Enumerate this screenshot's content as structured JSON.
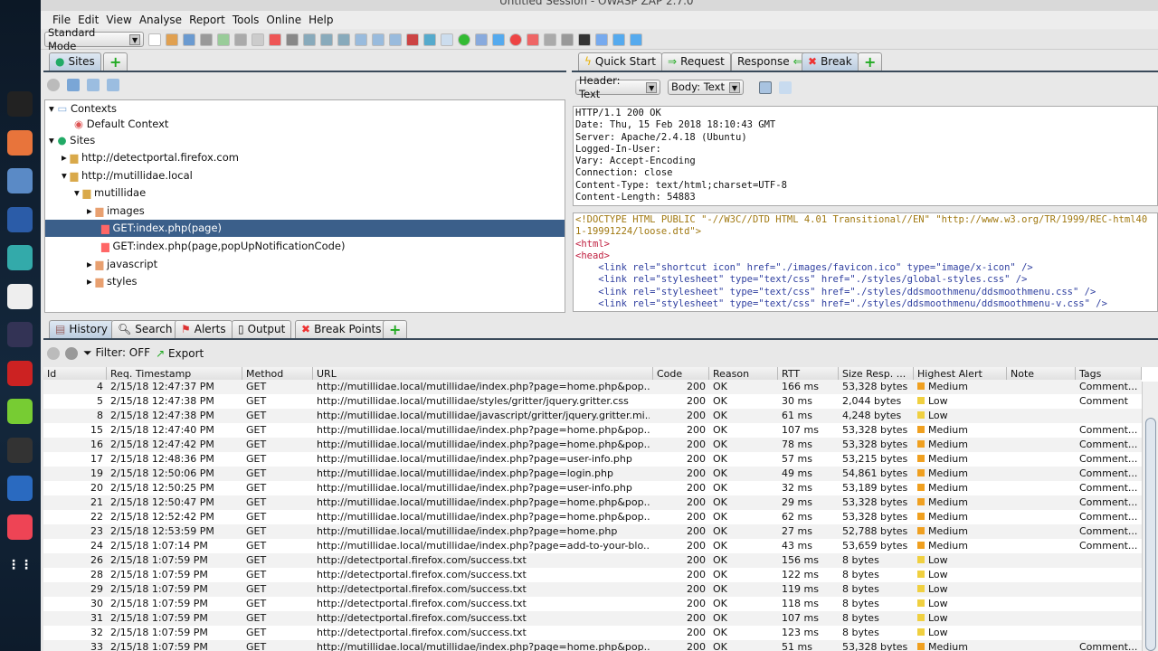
{
  "window": {
    "title": "Untitled Session - OWASP ZAP 2.7.0"
  },
  "dock": {
    "items": [
      "terminal-icon",
      "firefox-icon",
      "files-icon",
      "metasploit-icon",
      "armitage-icon",
      "maltego-icon",
      "beef-icon",
      "faraday-icon",
      "notes-icon",
      "leafpad-icon",
      "zap-icon",
      "burp-icon",
      "apps-grid-icon"
    ]
  },
  "menu": [
    "File",
    "Edit",
    "View",
    "Analyse",
    "Report",
    "Tools",
    "Online",
    "Help"
  ],
  "toolbar": {
    "mode": "Standard Mode"
  },
  "left_tabs": {
    "sites": "Sites"
  },
  "right_tabs": {
    "quick_start": "Quick Start",
    "request": "Request",
    "response": "Response",
    "break": "Break"
  },
  "viewer": {
    "header_select": "Header: Text",
    "body_select": "Body: Text"
  },
  "tree": {
    "contexts": "Contexts",
    "default_context": "Default Context",
    "sites": "Sites",
    "site1": "http://detectportal.firefox.com",
    "site2": "http://mutillidae.local",
    "folder": "mutillidae",
    "images": "images",
    "node_selected": "GET:index.php(page)",
    "node2": "GET:index.php(page,popUpNotificationCode)",
    "javascript": "javascript",
    "styles": "styles"
  },
  "response_header": "HTTP/1.1 200 OK\nDate: Thu, 15 Feb 2018 18:10:43 GMT\nServer: Apache/2.4.18 (Ubuntu)\nLogged-In-User:\nVary: Accept-Encoding\nConnection: close\nContent-Type: text/html;charset=UTF-8\nContent-Length: 54883",
  "response_body": {
    "doctype": "<!DOCTYPE HTML PUBLIC \"-//W3C//DTD HTML 4.01 Transitional//EN\" \"http://www.w3.org/TR/1999/REC-html40\n1-19991224/loose.dtd\">",
    "html": "<html>",
    "head": "<head>",
    "links": [
      "    <link rel=\"shortcut icon\" href=\"./images/favicon.ico\" type=\"image/x-icon\" />",
      "    <link rel=\"stylesheet\" type=\"text/css\" href=\"./styles/global-styles.css\" />",
      "    <link rel=\"stylesheet\" type=\"text/css\" href=\"./styles/ddsmoothmenu/ddsmoothmenu.css\" />",
      "    <link rel=\"stylesheet\" type=\"text/css\" href=\"./styles/ddsmoothmenu/ddsmoothmenu-v.css\" />"
    ]
  },
  "bottom_tabs": {
    "history": "History",
    "search": "Search",
    "alerts": "Alerts",
    "output": "Output",
    "break_points": "Break Points"
  },
  "history_toolbar": {
    "filter": "Filter: OFF",
    "export": "Export"
  },
  "colors": {
    "medium": "#f0a020",
    "low": "#f0d040",
    "selected": "#3b5f8a"
  },
  "history": {
    "columns": [
      "Id",
      "Req. Timestamp",
      "Method",
      "URL",
      "Code",
      "Reason",
      "RTT",
      "Size Resp. ...",
      "Highest Alert",
      "Note",
      "Tags"
    ],
    "rows": [
      [
        "4",
        "2/15/18 12:47:37 PM",
        "GET",
        "http://mutillidae.local/mutillidae/index.php?page=home.php&pop...",
        "200",
        "OK",
        "166 ms",
        "53,328 bytes",
        "Medium",
        "",
        "Comment..."
      ],
      [
        "5",
        "2/15/18 12:47:38 PM",
        "GET",
        "http://mutillidae.local/mutillidae/styles/gritter/jquery.gritter.css",
        "200",
        "OK",
        "30 ms",
        "2,044 bytes",
        "Low",
        "",
        "Comment"
      ],
      [
        "8",
        "2/15/18 12:47:38 PM",
        "GET",
        "http://mutillidae.local/mutillidae/javascript/gritter/jquery.gritter.mi...",
        "200",
        "OK",
        "61 ms",
        "4,248 bytes",
        "Low",
        "",
        ""
      ],
      [
        "15",
        "2/15/18 12:47:40 PM",
        "GET",
        "http://mutillidae.local/mutillidae/index.php?page=home.php&pop...",
        "200",
        "OK",
        "107 ms",
        "53,328 bytes",
        "Medium",
        "",
        "Comment..."
      ],
      [
        "16",
        "2/15/18 12:47:42 PM",
        "GET",
        "http://mutillidae.local/mutillidae/index.php?page=home.php&pop...",
        "200",
        "OK",
        "78 ms",
        "53,328 bytes",
        "Medium",
        "",
        "Comment..."
      ],
      [
        "17",
        "2/15/18 12:48:36 PM",
        "GET",
        "http://mutillidae.local/mutillidae/index.php?page=user-info.php",
        "200",
        "OK",
        "57 ms",
        "53,215 bytes",
        "Medium",
        "",
        "Comment..."
      ],
      [
        "19",
        "2/15/18 12:50:06 PM",
        "GET",
        "http://mutillidae.local/mutillidae/index.php?page=login.php",
        "200",
        "OK",
        "49 ms",
        "54,861 bytes",
        "Medium",
        "",
        "Comment..."
      ],
      [
        "20",
        "2/15/18 12:50:25 PM",
        "GET",
        "http://mutillidae.local/mutillidae/index.php?page=user-info.php",
        "200",
        "OK",
        "32 ms",
        "53,189 bytes",
        "Medium",
        "",
        "Comment..."
      ],
      [
        "21",
        "2/15/18 12:50:47 PM",
        "GET",
        "http://mutillidae.local/mutillidae/index.php?page=home.php&pop...",
        "200",
        "OK",
        "29 ms",
        "53,328 bytes",
        "Medium",
        "",
        "Comment..."
      ],
      [
        "22",
        "2/15/18 12:52:42 PM",
        "GET",
        "http://mutillidae.local/mutillidae/index.php?page=home.php&pop...",
        "200",
        "OK",
        "62 ms",
        "53,328 bytes",
        "Medium",
        "",
        "Comment..."
      ],
      [
        "23",
        "2/15/18 12:53:59 PM",
        "GET",
        "http://mutillidae.local/mutillidae/index.php?page=home.php",
        "200",
        "OK",
        "27 ms",
        "52,788 bytes",
        "Medium",
        "",
        "Comment..."
      ],
      [
        "24",
        "2/15/18 1:07:14 PM",
        "GET",
        "http://mutillidae.local/mutillidae/index.php?page=add-to-your-blo...",
        "200",
        "OK",
        "43 ms",
        "53,659 bytes",
        "Medium",
        "",
        "Comment..."
      ],
      [
        "26",
        "2/15/18 1:07:59 PM",
        "GET",
        "http://detectportal.firefox.com/success.txt",
        "200",
        "OK",
        "156 ms",
        "8 bytes",
        "Low",
        "",
        ""
      ],
      [
        "28",
        "2/15/18 1:07:59 PM",
        "GET",
        "http://detectportal.firefox.com/success.txt",
        "200",
        "OK",
        "122 ms",
        "8 bytes",
        "Low",
        "",
        ""
      ],
      [
        "29",
        "2/15/18 1:07:59 PM",
        "GET",
        "http://detectportal.firefox.com/success.txt",
        "200",
        "OK",
        "119 ms",
        "8 bytes",
        "Low",
        "",
        ""
      ],
      [
        "30",
        "2/15/18 1:07:59 PM",
        "GET",
        "http://detectportal.firefox.com/success.txt",
        "200",
        "OK",
        "118 ms",
        "8 bytes",
        "Low",
        "",
        ""
      ],
      [
        "31",
        "2/15/18 1:07:59 PM",
        "GET",
        "http://detectportal.firefox.com/success.txt",
        "200",
        "OK",
        "107 ms",
        "8 bytes",
        "Low",
        "",
        ""
      ],
      [
        "32",
        "2/15/18 1:07:59 PM",
        "GET",
        "http://detectportal.firefox.com/success.txt",
        "200",
        "OK",
        "123 ms",
        "8 bytes",
        "Low",
        "",
        ""
      ],
      [
        "33",
        "2/15/18 1:07:59 PM",
        "GET",
        "http://mutillidae.local/mutillidae/index.php?page=home.php&pop...",
        "200",
        "OK",
        "51 ms",
        "53,328 bytes",
        "Medium",
        "",
        "Comment..."
      ]
    ]
  }
}
